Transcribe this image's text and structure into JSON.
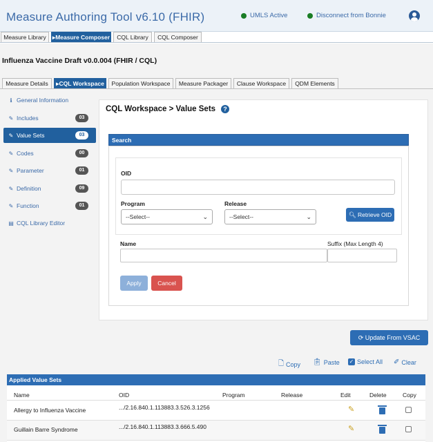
{
  "header": {
    "app_title": "Measure Authoring Tool v6.10 (FHIR)",
    "umls_status": "UMLS Active",
    "bonnie_status": "Disconnect from Bonnie"
  },
  "main_tabs": [
    {
      "label": "Measure Library"
    },
    {
      "label": "Measure Composer"
    },
    {
      "label": "CQL Library"
    },
    {
      "label": "CQL Composer"
    }
  ],
  "measure_title": "Influenza Vaccine Draft v0.0.004 (FHIR / CQL)",
  "sub_tabs": [
    {
      "label": "Measure Details"
    },
    {
      "label": "CQL Workspace"
    },
    {
      "label": "Population Workspace"
    },
    {
      "label": "Measure Packager"
    },
    {
      "label": "Clause Workspace"
    },
    {
      "label": "QDM Elements"
    }
  ],
  "sidebar": {
    "items": [
      {
        "label": "General Information",
        "icon": "info-icon"
      },
      {
        "label": "Includes",
        "icon": "pencil-icon",
        "count": "03"
      },
      {
        "label": "Value Sets",
        "icon": "pencil-icon",
        "count": "03"
      },
      {
        "label": "Codes",
        "icon": "pencil-icon",
        "count": "00"
      },
      {
        "label": "Parameter",
        "icon": "pencil-icon",
        "count": "01"
      },
      {
        "label": "Definition",
        "icon": "pencil-icon",
        "count": "09"
      },
      {
        "label": "Function",
        "icon": "pencil-icon",
        "count": "01"
      },
      {
        "label": "CQL Library Editor",
        "icon": "book-icon"
      }
    ]
  },
  "workspace": {
    "title": "CQL Workspace > Value Sets",
    "search_header": "Search",
    "oid_label": "OID",
    "program_label": "Program",
    "program_value": "--Select--",
    "release_label": "Release",
    "release_value": "--Select--",
    "retrieve_button": "Retrieve OID",
    "name_label": "Name",
    "suffix_label": "Suffix (Max Length 4)",
    "apply_button": "Apply",
    "cancel_button": "Cancel"
  },
  "update_vsac_button": "Update From VSAC",
  "actions": {
    "copy": "Copy",
    "paste": "Paste",
    "select_all": "Select All",
    "clear": "Clear"
  },
  "applied_value_sets": {
    "header": "Applied Value Sets",
    "columns": [
      "Name",
      "OID",
      "Program",
      "Release",
      "Edit",
      "Delete",
      "Copy"
    ],
    "rows": [
      {
        "name": "Allergy to Influenza Vaccine",
        "oid": ".../2.16.840.1.113883.3.526.3.1256"
      },
      {
        "name": "Guillain Barre Syndrome",
        "oid": ".../2.16.840.1.113883.3.666.5.490"
      }
    ]
  },
  "colors": {
    "brand_blue": "#21609e",
    "panel_blue": "#2d6db4",
    "status_green": "#1a7d25",
    "cancel_red": "#d9534f"
  }
}
